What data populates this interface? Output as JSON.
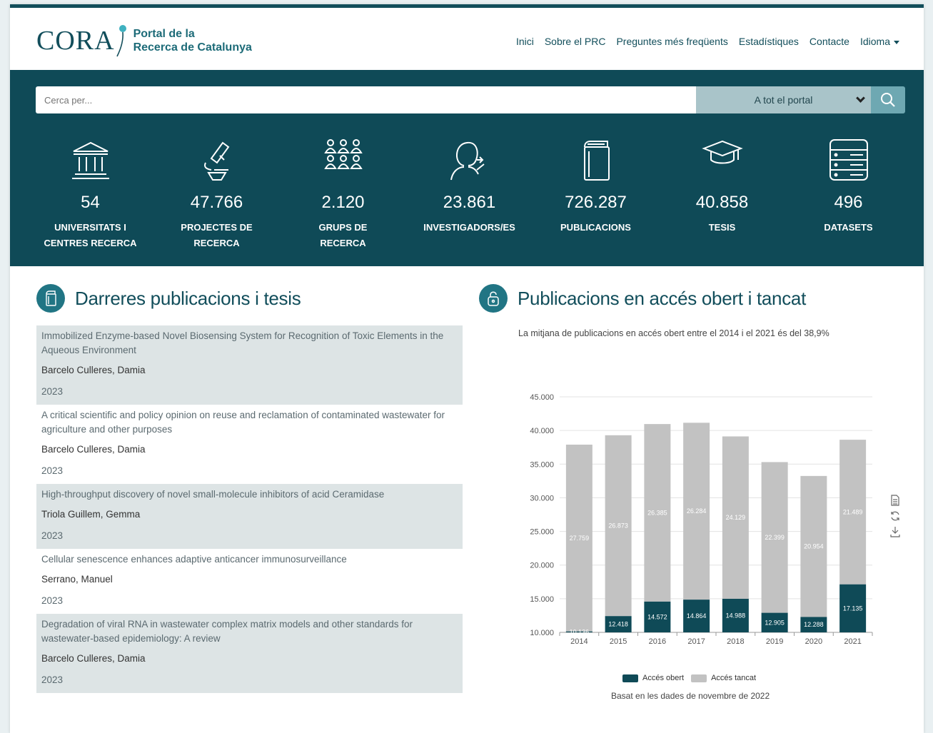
{
  "logo": {
    "word": "CORA",
    "sub_line1": "Portal de la",
    "sub_line2": "Recerca de Catalunya"
  },
  "nav": {
    "items": [
      "Inici",
      "Sobre el PRC",
      "Preguntes més freqüents",
      "Estadístiques",
      "Contacte"
    ],
    "language": "Idioma"
  },
  "search": {
    "placeholder": "Cerca per...",
    "scope": "A tot el portal"
  },
  "stats": [
    {
      "icon": "institution-icon",
      "value": "54",
      "label1": "UNIVERSITATS I",
      "label2": "CENTRES RECERCA"
    },
    {
      "icon": "microscope-icon",
      "value": "47.766",
      "label1": "PROJECTES DE",
      "label2": "RECERCA"
    },
    {
      "icon": "groups-icon",
      "value": "2.120",
      "label1": "GRUPS DE",
      "label2": "RECERCA"
    },
    {
      "icon": "researchers-icon",
      "value": "23.861",
      "label1": "INVESTIGADORS/ES",
      "label2": ""
    },
    {
      "icon": "books-icon",
      "value": "726.287",
      "label1": "PUBLICACIONS",
      "label2": ""
    },
    {
      "icon": "graduation-cap-icon",
      "value": "40.858",
      "label1": "TESIS",
      "label2": ""
    },
    {
      "icon": "database-icon",
      "value": "496",
      "label1": "DATASETS",
      "label2": ""
    }
  ],
  "publications": {
    "title": "Darreres publicacions i tesis",
    "items": [
      {
        "title": "Immobilized Enzyme-based Novel Biosensing System for Recognition of Toxic Elements in the Aqueous Environment",
        "author": "Barcelo Culleres, Damia",
        "year": "2023"
      },
      {
        "title": "A critical scientific and policy opinion on reuse and reclamation of contaminated wastewater for agriculture and other purposes",
        "author": "Barcelo Culleres, Damia",
        "year": "2023"
      },
      {
        "title": "High-throughput discovery of novel small-molecule inhibitors of acid Ceramidase",
        "author": "Triola Guillem, Gemma",
        "year": "2023"
      },
      {
        "title": "Cellular senescence enhances adaptive anticancer immunosurveillance",
        "author": "Serrano, Manuel",
        "year": "2023"
      },
      {
        "title": "Degradation of viral RNA in wastewater complex matrix models and other standards for wastewater-based epidemiology: A review",
        "author": "Barcelo Culleres, Damia",
        "year": "2023"
      }
    ]
  },
  "access": {
    "title": "Publicacions en accés obert i tancat",
    "subtitle": "La mitjana de publicacions en accés obert entre el 2014 i el 2021 és del 38,9%",
    "footnote": "Basat en les dades de novembre de 2022"
  },
  "chart_data": {
    "type": "bar",
    "stacked": true,
    "categories": [
      "2014",
      "2015",
      "2016",
      "2017",
      "2018",
      "2019",
      "2020",
      "2021"
    ],
    "series": [
      {
        "name": "Accés obert",
        "color": "#0f4a57",
        "values": [
          10136,
          12418,
          14572,
          14864,
          14988,
          12905,
          12288,
          17135
        ],
        "labels": [
          "10.136",
          "12.418",
          "14.572",
          "14.864",
          "14.988",
          "12.905",
          "12.288",
          "17.135"
        ]
      },
      {
        "name": "Accés tancat",
        "color": "#c2c2c2",
        "values": [
          27759,
          26873,
          26385,
          26284,
          24129,
          22399,
          20954,
          21489
        ],
        "labels": [
          "27.759",
          "26.873",
          "26.385",
          "26.284",
          "24.129",
          "22.399",
          "20.954",
          "21.489"
        ]
      }
    ],
    "ylim": [
      10000,
      45000
    ],
    "yticks": [
      10000,
      15000,
      20000,
      25000,
      30000,
      35000,
      40000,
      45000
    ],
    "ytick_labels": [
      "10.000",
      "15.000",
      "20.000",
      "25.000",
      "30.000",
      "35.000",
      "40.000",
      "45.000"
    ],
    "grid": true,
    "legend_position": "bottom"
  }
}
